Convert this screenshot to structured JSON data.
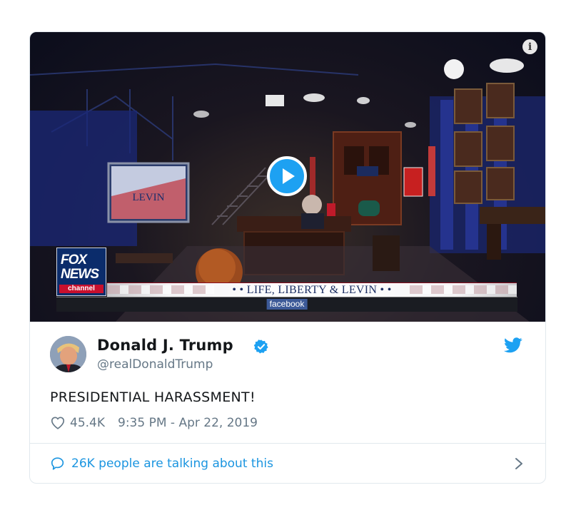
{
  "video": {
    "info_icon_glyph": "i",
    "play_icon": "play-icon",
    "network_logo": {
      "line1": "FOX",
      "line2": "NEWS",
      "line3": "channel"
    },
    "lower_third_title": "• • LIFE, LIBERTY & LEVIN • •",
    "ticker_badge": "facebook"
  },
  "tweet": {
    "author_name": "Donald J. Trump",
    "handle": "@realDonaldTrump",
    "verified_icon": "verified-badge-icon",
    "brand_icon": "twitter-bird-icon",
    "text": "PRESIDENTIAL HARASSMENT!",
    "likes": "45.4K",
    "timestamp": "9:35 PM - Apr 22, 2019",
    "conversation_label": "26K people are talking about this"
  },
  "colors": {
    "twitter_blue": "#1da1f2",
    "link_blue": "#1b95e0",
    "secondary_text": "#657786",
    "border": "#e1e8ed"
  }
}
